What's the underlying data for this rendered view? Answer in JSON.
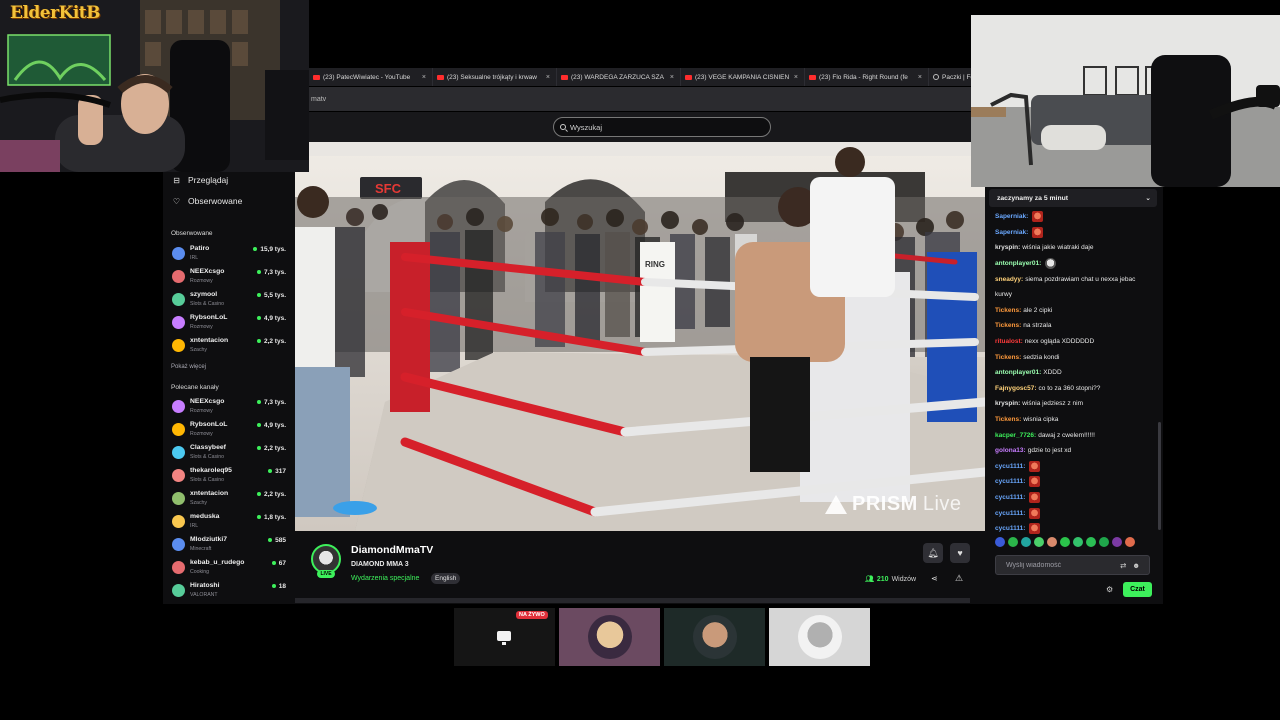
{
  "browser": {
    "tabs": [
      {
        "label": "(23) PatecWiwiatec - YouTube",
        "icon": "youtube-icon"
      },
      {
        "label": "(23) Seksualne trójkąty i krwaw",
        "icon": "youtube-icon"
      },
      {
        "label": "(23) WARDEGA ZARZUCA SZA",
        "icon": "youtube-icon"
      },
      {
        "label": "(23) VEGE KAMPANIA CIŚNIEN",
        "icon": "youtube-icon"
      },
      {
        "label": "(23) Flo Rida - Right Round (fe",
        "icon": "youtube-icon"
      },
      {
        "label": "Paczki | Fo",
        "icon": "globe-icon"
      }
    ],
    "tab_close": "×",
    "address": "matv"
  },
  "search": {
    "placeholder": "Wyszukaj"
  },
  "sidebar": {
    "nav": [
      {
        "label": "Przeglądaj",
        "icon": "browse-icon"
      },
      {
        "label": "Obserwowane",
        "icon": "heart-icon"
      }
    ],
    "followed_title": "Obserwowane",
    "followed": [
      {
        "name": "Patiro",
        "category": "IRL",
        "viewers": "15,9 tys."
      },
      {
        "name": "NEEXcsgo",
        "category": "Rozmowy",
        "viewers": "7,3 tys."
      },
      {
        "name": "szymool",
        "category": "Slots & Casino",
        "viewers": "5,5 tys."
      },
      {
        "name": "RybsonLoL",
        "category": "Rozmowy",
        "viewers": "4,9 tys."
      },
      {
        "name": "xntentacion",
        "category": "Szachy",
        "viewers": "2,2 tys."
      }
    ],
    "show_more": "Pokaż więcej",
    "recommended_title": "Polecane kanały",
    "recommended": [
      {
        "name": "NEEXcsgo",
        "category": "Rozmowy",
        "viewers": "7,3 tys."
      },
      {
        "name": "RybsonLoL",
        "category": "Rozmowy",
        "viewers": "4,9 tys."
      },
      {
        "name": "Classybeef",
        "category": "Slots & Casino",
        "viewers": "2,2 tys."
      },
      {
        "name": "thekaroleq95",
        "category": "Slots & Casino",
        "viewers": "317"
      },
      {
        "name": "xntentacion",
        "category": "Szachy",
        "viewers": "2,2 tys."
      },
      {
        "name": "meduska",
        "category": "IRL",
        "viewers": "1,8 tys."
      },
      {
        "name": "Mlodziutki7",
        "category": "Minecraft",
        "viewers": "585"
      },
      {
        "name": "kebab_u_rudego",
        "category": "Cooking",
        "viewers": "67"
      },
      {
        "name": "Hiratoshi",
        "category": "VALORANT",
        "viewers": "18"
      }
    ]
  },
  "video": {
    "watermark_strong": "PRISM",
    "watermark_light": "Live",
    "ring_sign": "RING",
    "banner": "SFC"
  },
  "stream": {
    "streamer": "DiamondMmaTV",
    "title": "DIAMOND MMA 3",
    "category": "Wydarzenia specjalne",
    "tag": "English",
    "live_label": "LIVE",
    "viewer_count": "210",
    "viewer_label": "Widzów"
  },
  "chat": {
    "pinned": "zaczynamy za 5 minut",
    "messages": [
      {
        "user": "Saperniak:",
        "color": "#6aa8ff",
        "text": "",
        "emote": "red"
      },
      {
        "user": "Saperniak:",
        "color": "#6aa8ff",
        "text": "",
        "emote": "red"
      },
      {
        "user": "kryspin:",
        "color": "#e0e0e0",
        "text": "wiśnia jakie wiatraki daje",
        "emote": ""
      },
      {
        "user": "antonplayer01:",
        "color": "#9bffb0",
        "text": "",
        "emote": "grey"
      },
      {
        "user": "sneadyy:",
        "color": "#ffd27a",
        "text": "siema pozdrawiam chat u nexxa jebac",
        "emote": ""
      },
      {
        "user": "",
        "color": "#ffd27a",
        "text": "kurwy",
        "emote": ""
      },
      {
        "user": "Tickens:",
        "color": "#ff9a3c",
        "text": "ale 2 cipki",
        "emote": ""
      },
      {
        "user": "Tickens:",
        "color": "#ff9a3c",
        "text": "na strzala",
        "emote": ""
      },
      {
        "user": "ritualost:",
        "color": "#ff3b3b",
        "text": "nexx ogląda XDDDDDD",
        "emote": ""
      },
      {
        "user": "Tickens:",
        "color": "#ff9a3c",
        "text": "sedzia kondi",
        "emote": ""
      },
      {
        "user": "antonplayer01:",
        "color": "#9bffb0",
        "text": "XDDD",
        "emote": ""
      },
      {
        "user": "Fajnygosc57:",
        "color": "#ffd27a",
        "text": "co to za 360 stopni??",
        "emote": ""
      },
      {
        "user": "kryspin:",
        "color": "#e0e0e0",
        "text": "wiśnia jedziesz z nim",
        "emote": ""
      },
      {
        "user": "Tickens:",
        "color": "#ff9a3c",
        "text": "wisnia cipka",
        "emote": ""
      },
      {
        "user": "kacper_7726:",
        "color": "#3df05b",
        "text": "dawaj z cwelem!!!!!!",
        "emote": ""
      },
      {
        "user": "golona13:",
        "color": "#c77dff",
        "text": "gdzie to jest xd",
        "emote": ""
      },
      {
        "user": "cycu1111:",
        "color": "#6aa8ff",
        "text": "",
        "emote": "red"
      },
      {
        "user": "cycu1111:",
        "color": "#6aa8ff",
        "text": "",
        "emote": "red"
      },
      {
        "user": "cycu1111:",
        "color": "#6aa8ff",
        "text": "",
        "emote": "red"
      },
      {
        "user": "cycu1111:",
        "color": "#6aa8ff",
        "text": "",
        "emote": "red"
      },
      {
        "user": "cycu1111:",
        "color": "#6aa8ff",
        "text": "",
        "emote": "red"
      }
    ],
    "emote_colors": [
      "#3a5bd9",
      "#2bb54a",
      "#22a5a0",
      "#4bd06a",
      "#d98a6c",
      "#2bc44b",
      "#33c26b",
      "#2bbf55",
      "#1fa64b",
      "#7b3aa3",
      "#e06b4c"
    ],
    "input_placeholder": "Wyślij wiadomość",
    "send_label": "Czat"
  },
  "overlay": {
    "logo": "ElderKitB",
    "on_air": "NA ŻYWO"
  },
  "colors": {
    "accent": "#3df05b",
    "bg": "#0e0e10",
    "panel": "#18181b"
  }
}
